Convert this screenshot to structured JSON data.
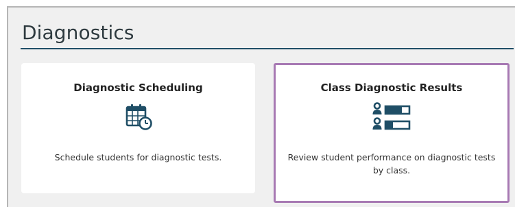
{
  "section": {
    "title": "Diagnostics"
  },
  "cards": [
    {
      "title": "Diagnostic Scheduling",
      "description": "Schedule students for diagnostic tests.",
      "icon": "calendar-clock-icon"
    },
    {
      "title": "Class Diagnostic Results",
      "description": "Review student performance on diagnostic tests by class.",
      "icon": "student-results-icon",
      "highlighted": true
    }
  ],
  "colors": {
    "accent": "#1f4e66",
    "highlight_border": "#a779b3",
    "page_background": "#f0f0f0",
    "card_background": "#ffffff"
  }
}
